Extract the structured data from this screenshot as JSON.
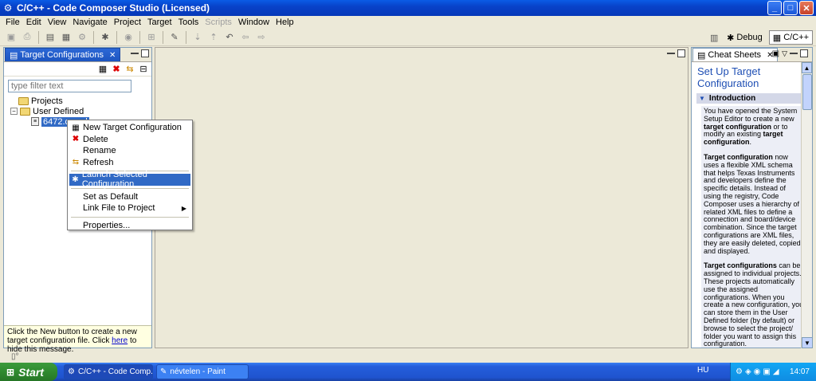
{
  "window": {
    "title": "C/C++ - Code Composer Studio (Licensed)",
    "minimize": "_",
    "maximize": "□",
    "close": "✕"
  },
  "menu": [
    "File",
    "Edit",
    "View",
    "Navigate",
    "Project",
    "Target",
    "Tools",
    "Scripts",
    "Window",
    "Help"
  ],
  "menu_disabled": [
    "Scripts"
  ],
  "perspectives": {
    "debug": "Debug",
    "cpp": "C/C++"
  },
  "left_panel": {
    "tab_label": "Target Configurations",
    "filter_placeholder": "type filter text",
    "tree": {
      "projects": "Projects",
      "user_defined": "User Defined",
      "file": "6472.ccxml"
    },
    "hint_prefix": "Click the New button to create a new target configuration file. Click ",
    "hint_link": "here",
    "hint_suffix": " to hide this message."
  },
  "context_menu": {
    "new": "New Target Configuration",
    "delete": "Delete",
    "rename": "Rename",
    "refresh": "Refresh",
    "launch": "Launch Selected Configuration",
    "set_default": "Set as Default",
    "link_file": "Link File to Project",
    "properties": "Properties..."
  },
  "cheat_sheet": {
    "tab_label": "Cheat Sheets",
    "title": "Set Up Target Configuration",
    "section": "Introduction",
    "p1_a": "You have opened the System Setup Editor to create a new ",
    "p1_b": "target configuration",
    "p1_c": " or to modify an existing ",
    "p1_d": "target configuration",
    "p1_e": ".",
    "p2_a": "Target configuration",
    "p2_b": " now uses a flexible XML schema that helps Texas Instruments and developers define the specific details. Instead of using the registry, Code Composer uses a hierarchy of related XML files to define a connection and board/device combination. Since the target configurations are XML files, they are easily deleted, copied, and displayed.",
    "p3_a": "Target configurations",
    "p3_b": " can be assigned to individual projects. These projects automatically use the assigned configurations. When you create a new configuration, you can store them in the User Defined folder (by default) or browse to select the project/ folder you want to assign this configuration."
  },
  "taskbar": {
    "start": "Start",
    "task1": "C/C++ - Code Comp...",
    "task2": "névtelen - Paint",
    "lang": "HU",
    "clock": "14:07"
  }
}
